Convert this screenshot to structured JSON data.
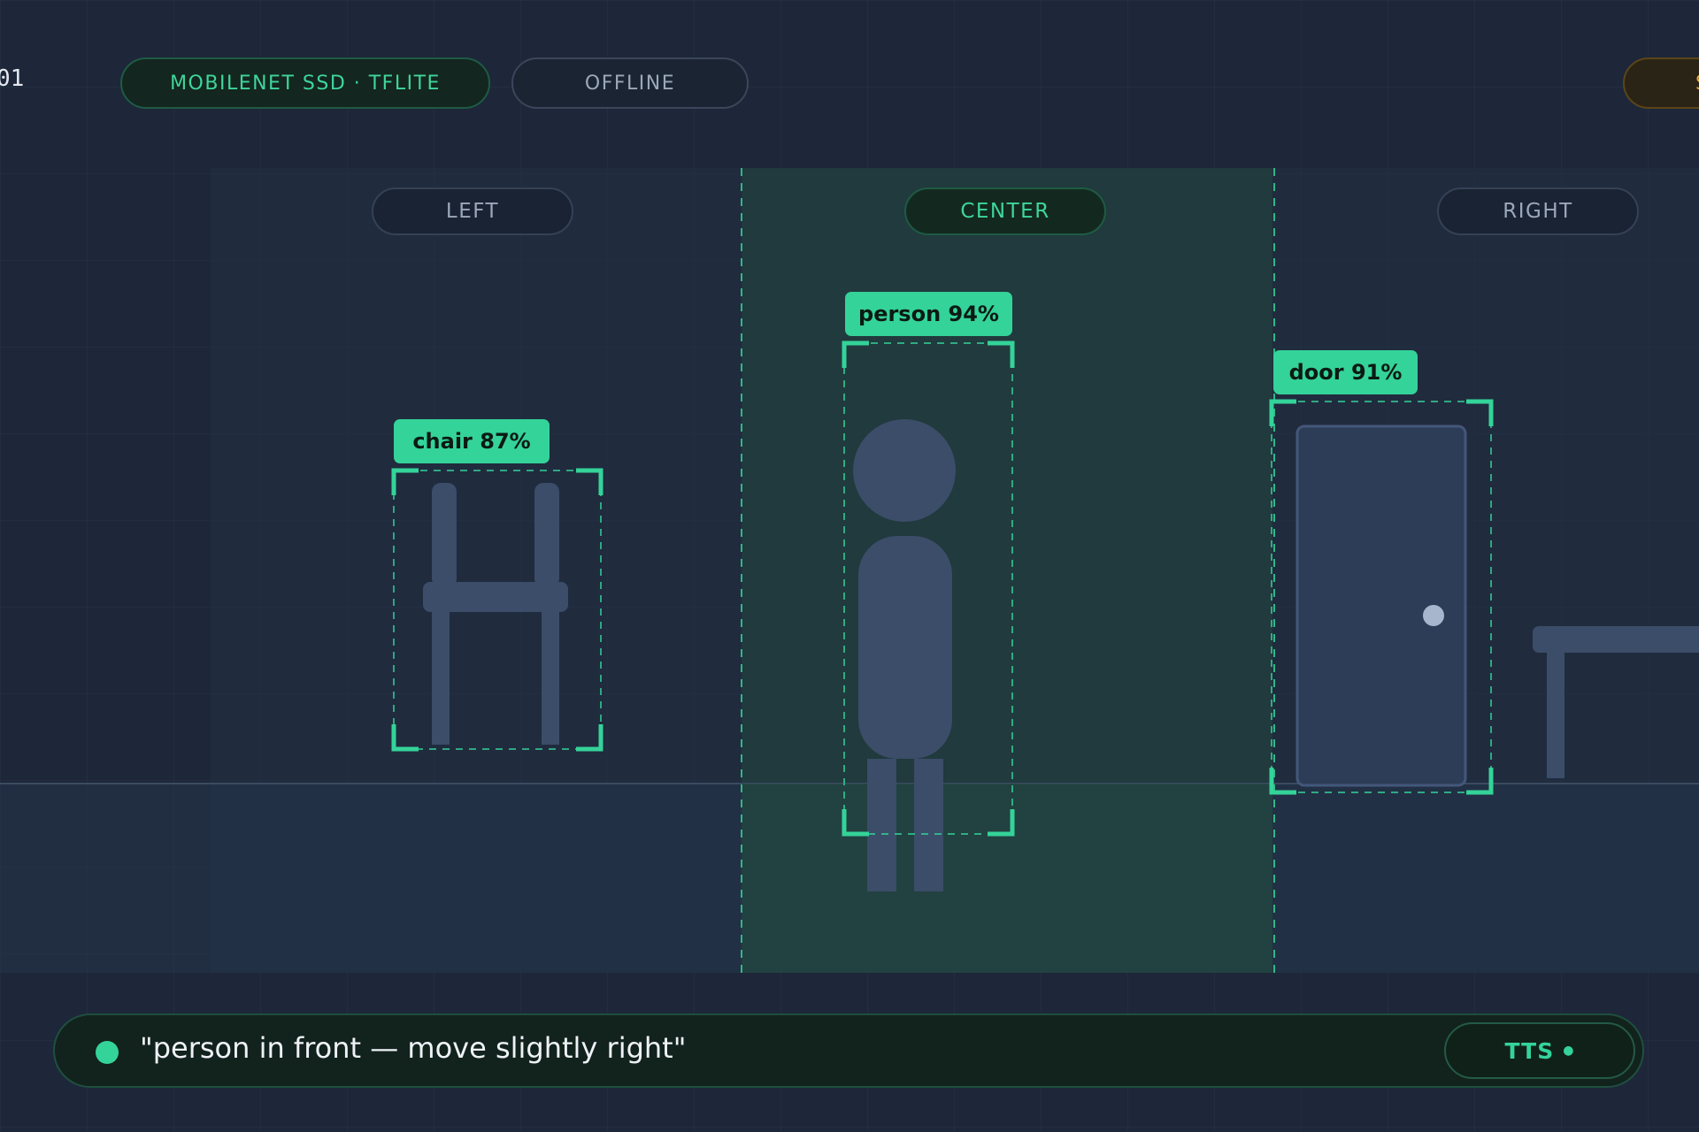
{
  "header": {
    "frame_counter": "01",
    "model_label": "MOBILENET SSD · TFLITE",
    "mode_label": "OFFLINE",
    "status_label": "S"
  },
  "zones": {
    "left": "LEFT",
    "center": "CENTER",
    "right": "RIGHT",
    "active": "center"
  },
  "detections": [
    {
      "label": "chair 87%",
      "object": "chair",
      "confidence": 87,
      "zone": "left"
    },
    {
      "label": "person 94%",
      "object": "person",
      "confidence": 94,
      "zone": "center"
    },
    {
      "label": "door 91%",
      "object": "door",
      "confidence": 91,
      "zone": "right"
    }
  ],
  "speech": {
    "text": "\"person in front — move slightly right\"",
    "tts_label": "TTS"
  },
  "colors": {
    "accent": "#34d399",
    "background": "#1d2739",
    "object_fill": "#3b4d68",
    "warning": "#e6a542"
  }
}
